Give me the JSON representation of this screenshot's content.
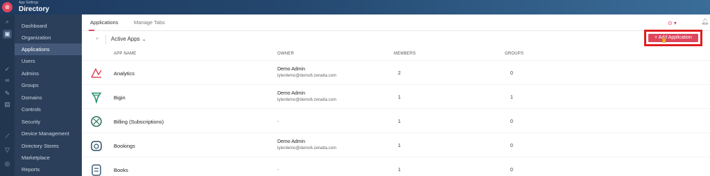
{
  "header": {
    "subtitle": "App Settings",
    "title": "Directory"
  },
  "rail_icons": [
    "search-icon",
    "apps-icon",
    "check-icon",
    "link-icon",
    "document-icon",
    "stores-icon",
    "analytics-icon",
    "filter-icon",
    "shield-icon"
  ],
  "sidebar": {
    "items": [
      {
        "label": "Dashboard"
      },
      {
        "label": "Organization"
      },
      {
        "label": "Applications"
      },
      {
        "label": "Users"
      },
      {
        "label": "Admins"
      },
      {
        "label": "Groups"
      },
      {
        "label": "Domains"
      },
      {
        "label": "Controls"
      },
      {
        "label": "Security"
      },
      {
        "label": "Device Management"
      },
      {
        "label": "Directory Stores"
      },
      {
        "label": "Marketplace"
      },
      {
        "label": "Reports"
      }
    ]
  },
  "tabs": [
    {
      "label": "Applications"
    },
    {
      "label": "Manage Tabs"
    }
  ],
  "filter": {
    "selected": "Active Apps"
  },
  "add_button": {
    "label": "+ Add Application"
  },
  "table": {
    "headers": {
      "app": "APP NAME",
      "owner": "OWNER",
      "members": "MEMBERS",
      "groups": "GROUPS"
    },
    "rows": [
      {
        "name": "Analytics",
        "owner_name": "Demo Admin",
        "owner_email": "tylerdemo@demo6.zenatta.com",
        "members": "2",
        "groups": "0",
        "icon": "analytics-icon"
      },
      {
        "name": "Bigin",
        "owner_name": "Demo Admin",
        "owner_email": "tylerdemo@demo6.zenatta.com",
        "members": "1",
        "groups": "1",
        "icon": "bigin-icon"
      },
      {
        "name": "Billing (Subscriptions)",
        "owner_name": "-",
        "owner_email": "",
        "members": "1",
        "groups": "0",
        "icon": "billing-icon"
      },
      {
        "name": "Bookings",
        "owner_name": "Demo Admin",
        "owner_email": "tylerdemo@demo6.zenatta.com",
        "members": "1",
        "groups": "0",
        "icon": "bookings-icon"
      },
      {
        "name": "Books",
        "owner_name": "-",
        "owner_email": "",
        "members": "1",
        "groups": "0",
        "icon": "books-icon"
      }
    ]
  },
  "colors": {
    "accent": "#e0455e",
    "sidebar_bg": "#2b3f5a",
    "highlight_box": "#e01c1c"
  }
}
